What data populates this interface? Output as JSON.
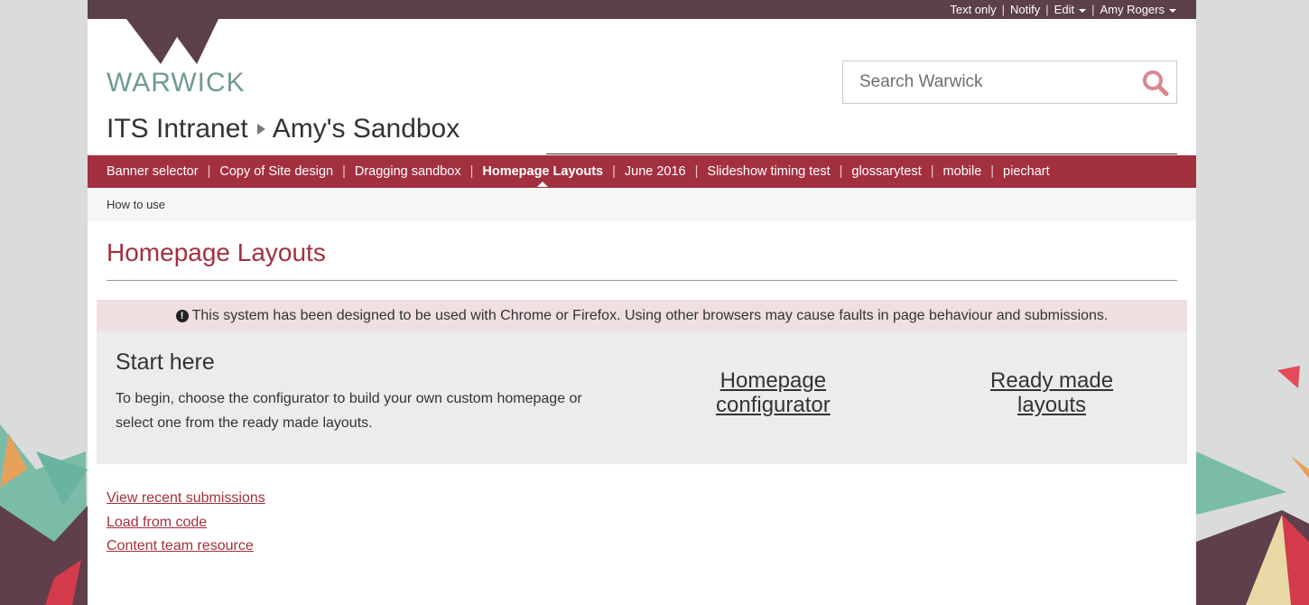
{
  "utility_bar": {
    "text_only": "Text only",
    "notify": "Notify",
    "edit": "Edit",
    "user": "Amy Rogers",
    "separator": "|"
  },
  "brand": {
    "logo_text": "WARWICK",
    "accent_color": "#a3303f",
    "bar_color": "#5b3f4a"
  },
  "search": {
    "placeholder": "Search Warwick",
    "value": ""
  },
  "site": {
    "parent": "ITS Intranet",
    "current": "Amy's Sandbox"
  },
  "nav": {
    "items": [
      {
        "label": "Banner selector"
      },
      {
        "label": "Copy of Site design"
      },
      {
        "label": "Dragging sandbox"
      },
      {
        "label": "Homepage Layouts",
        "active": true
      },
      {
        "label": "June 2016"
      },
      {
        "label": "Slideshow timing test"
      },
      {
        "label": "glossarytest"
      },
      {
        "label": "mobile"
      },
      {
        "label": "piechart"
      }
    ],
    "separator": "|"
  },
  "subnav": {
    "how_to_use": "How to use"
  },
  "page": {
    "heading": "Homepage Layouts",
    "alert": "This system has been designed to be used with Chrome or Firefox. Using other browsers may cause faults in page behaviour and submissions.",
    "alert_icon": "!",
    "panel": {
      "title": "Start here",
      "text": "To begin, choose the configurator to build your own custom homepage or select one from the ready made layouts.",
      "configurator_line1": "Homepage",
      "configurator_line2": "configurator",
      "ready_line1": "Ready made",
      "ready_line2": "layouts"
    },
    "links": {
      "recent": "View recent submissions",
      "load": "Load from code",
      "content": "Content team resource"
    }
  }
}
